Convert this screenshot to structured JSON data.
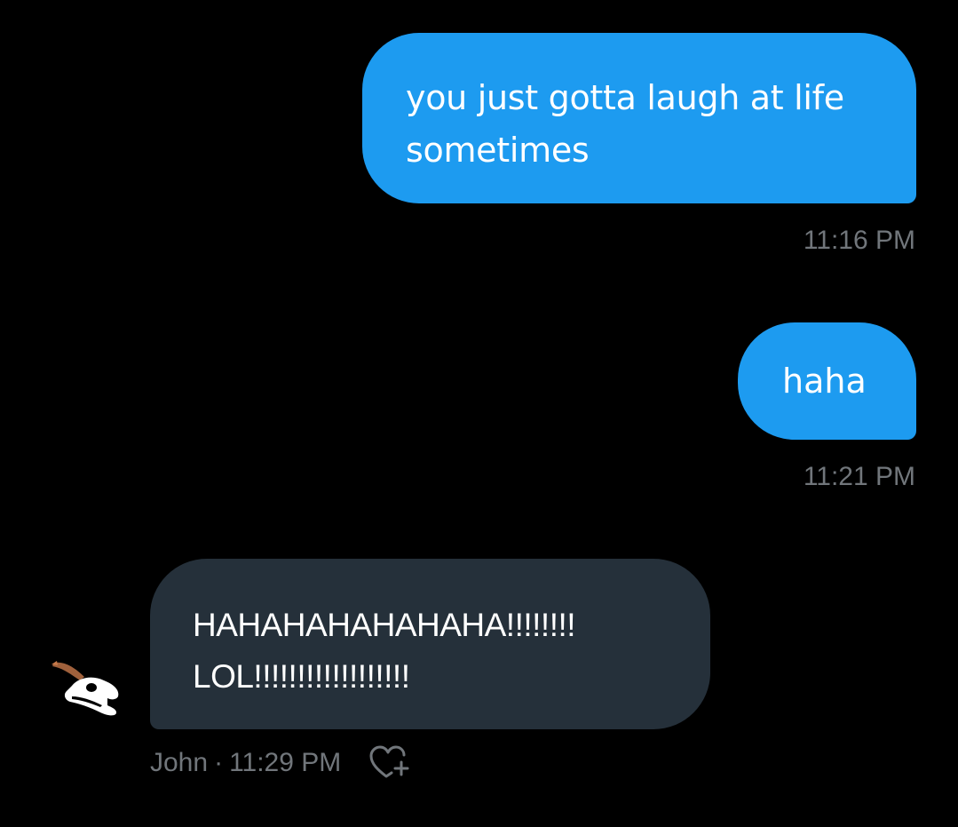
{
  "conversation": {
    "messages": [
      {
        "direction": "sent",
        "text": "you just gotta laugh at life\nsometimes",
        "time": "11:16 PM"
      },
      {
        "direction": "sent",
        "text": "haha",
        "time": "11:21 PM"
      },
      {
        "direction": "received",
        "text": "HAHAHAHAHAHAHA!!!!!!!!\nLOL!!!!!!!!!!!!!!!!!!",
        "sender": "John",
        "separator": "·",
        "time": "11:29 PM",
        "avatar_icon": "dinosaur-skull-avatar-icon",
        "reaction_icon": "heart-plus-icon"
      }
    ]
  },
  "colors": {
    "background": "#000000",
    "sent_bubble": "#1d9bf0",
    "received_bubble": "#25303a",
    "timestamp": "#71767b",
    "message_text": "#ffffff"
  }
}
